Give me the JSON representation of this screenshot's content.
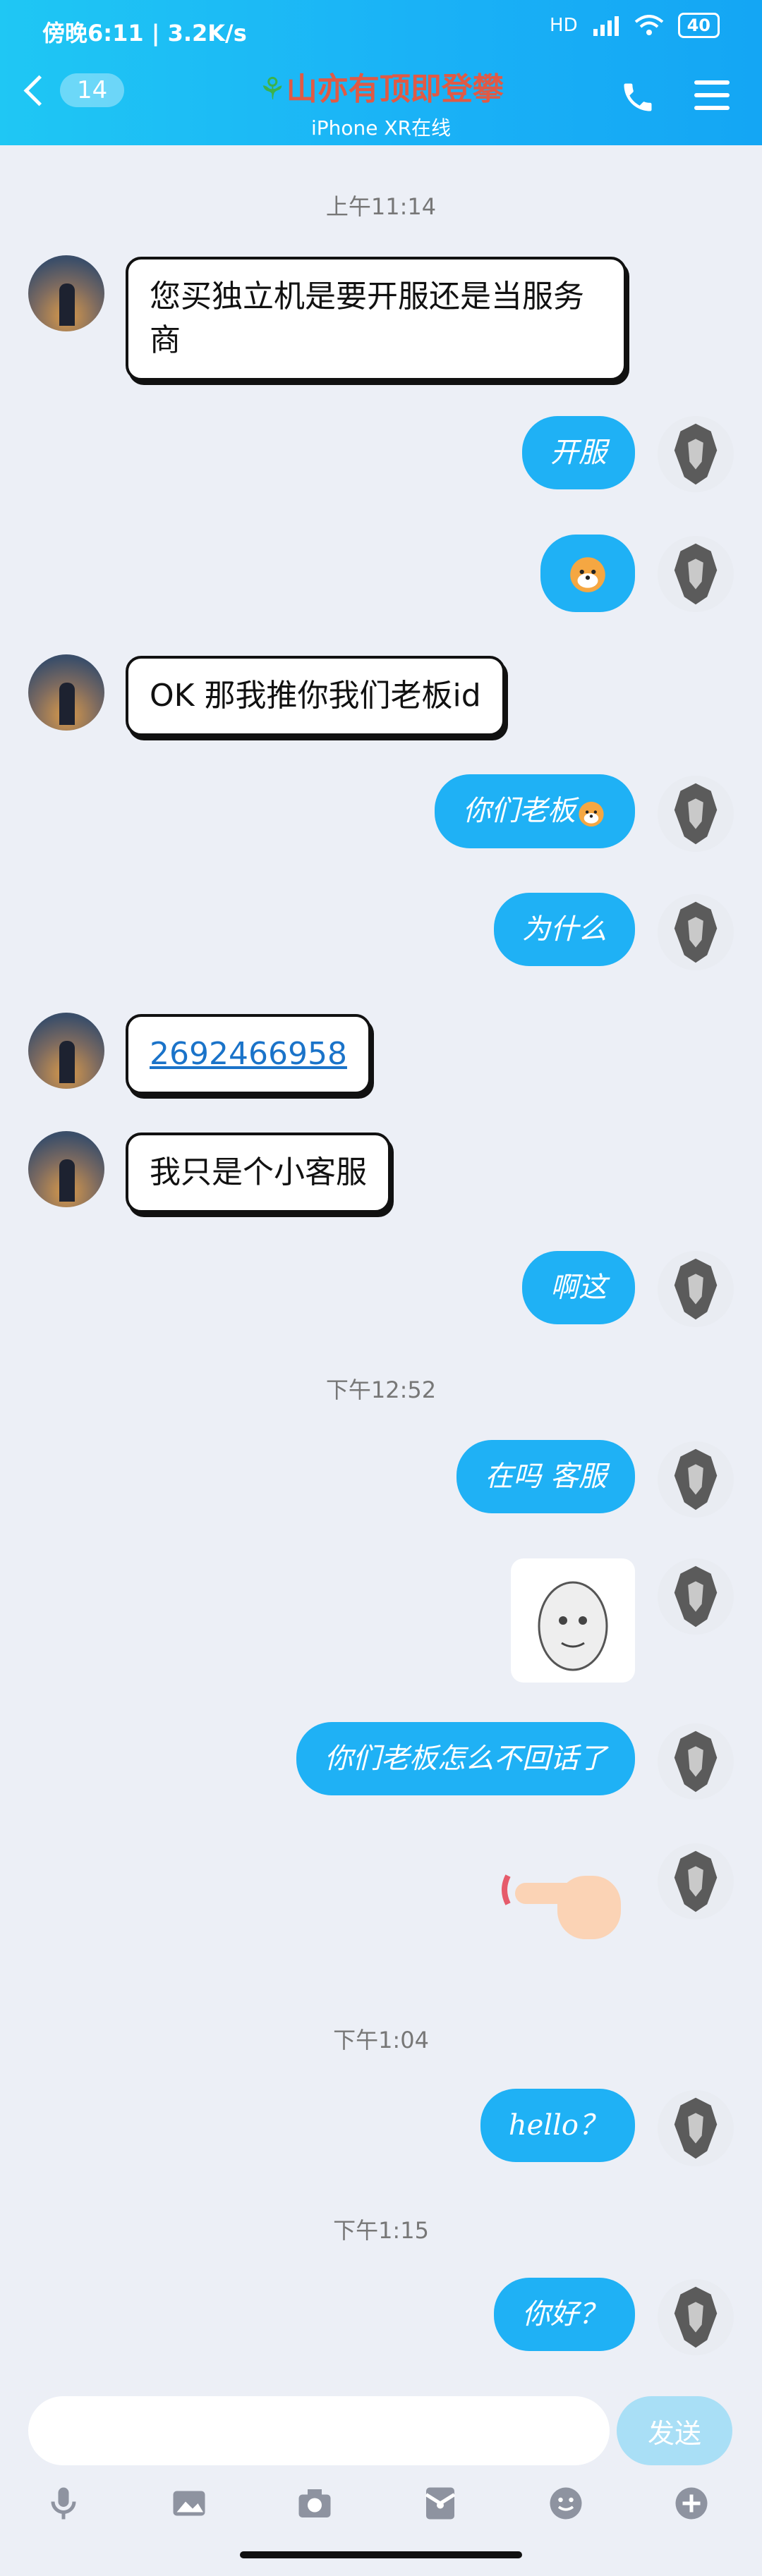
{
  "status": {
    "time_speed": "傍晚6:11 | 3.2K/s",
    "network": "HD",
    "battery": "40"
  },
  "header": {
    "back_count": "14",
    "title": "山亦有顶即登攀",
    "subtitle": "iPhone XR在线"
  },
  "timestamps": [
    "上午11:14",
    "下午12:52",
    "下午1:04",
    "下午1:15"
  ],
  "messages": {
    "m1": "您买独立机是要开服还是当服务商",
    "m2": "开服",
    "m4": "OK 那我推你我们老板id",
    "m5": "你们老板",
    "m6": "为什么",
    "m7": "2692466958",
    "m8": "我只是个小客服",
    "m9": "啊这",
    "m10": "在吗 客服",
    "m12": "你们老板怎么不回话了",
    "m14": "hello？",
    "m15": "你好？"
  },
  "input": {
    "send_label": "发送"
  },
  "icons": [
    "mic-icon",
    "image-icon",
    "camera-icon",
    "red-packet-icon",
    "emoji-icon",
    "plus-icon"
  ]
}
